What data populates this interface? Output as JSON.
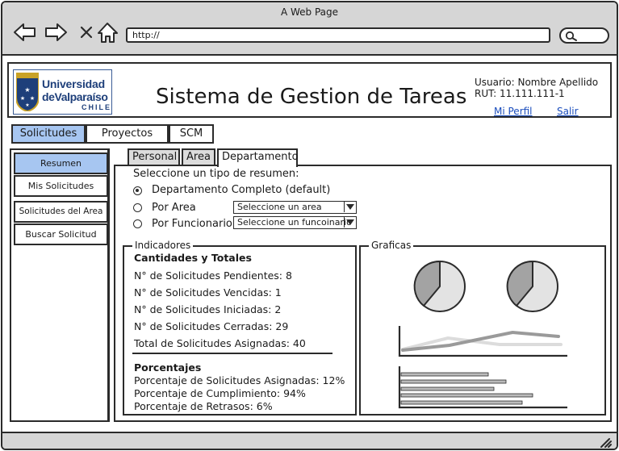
{
  "browser": {
    "title": "A Web Page",
    "url": "http://"
  },
  "header": {
    "logo": {
      "line1": "Universidad",
      "line2": "deValparaíso",
      "line3": "CHILE"
    },
    "title": "Sistema de Gestion de Tareas",
    "user_label": "Usuario: Nombre Apellido",
    "rut_label": "RUT: 11.111.111-1",
    "profile_link": "Mi Perfil",
    "logout_link": "Salir"
  },
  "top_tabs": [
    {
      "label": "Solicitudes",
      "active": true
    },
    {
      "label": "Proyectos",
      "active": false
    },
    {
      "label": "SCM",
      "active": false
    }
  ],
  "sidebar": {
    "items": [
      {
        "label": "Resumen",
        "active": true
      },
      {
        "label": "Mis Solicitudes",
        "active": false
      },
      {
        "label": "Solicitudes del Area",
        "active": false
      },
      {
        "label": "Buscar Solicitud",
        "active": false
      }
    ]
  },
  "sub_tabs": [
    {
      "label": "Personal",
      "active": false
    },
    {
      "label": "Area",
      "active": false
    },
    {
      "label": "Departamento",
      "active": true
    }
  ],
  "summary_type": {
    "prompt": "Seleccione un tipo de resumen:",
    "options": [
      {
        "label": "Departamento Completo (default)",
        "selected": true
      },
      {
        "label": "Por Area",
        "selected": false,
        "select_value": "Seleccione un area"
      },
      {
        "label": "Por Funcionario",
        "selected": false,
        "select_value": "Seleccione un funcoinario"
      }
    ]
  },
  "indicators": {
    "legend": "Indicadores",
    "totals_title": "Cantidades y Totales",
    "totals": [
      "N° de Solicitudes Pendientes: 8",
      "N° de Solicitudes Vencidas: 1",
      "N° de Solicitudes Iniciadas: 2",
      "N° de Solicitudes Cerradas: 29",
      "Total de Solicitudes Asignadas: 40"
    ],
    "percent_title": "Porcentajes",
    "percentages": [
      "Porcentaje de Solicitudes Asignadas: 12%",
      "Porcentaje de Cumplimiento: 94%",
      "Porcentaje de Retrasos: 6%"
    ]
  },
  "graphs": {
    "legend": "Graficas"
  },
  "colors": {
    "active_tab": "#a7c6f1",
    "chrome": "#d6d6d6",
    "link": "#1a4dbd",
    "logo_blue": "#1e3f7a",
    "pie_dark": "#a3a3a3",
    "pie_light": "#e3e3e3",
    "line_dark": "#9a9a9a",
    "line_light": "#dcdcdc"
  },
  "icons": [
    "back-arrow-icon",
    "forward-arrow-icon",
    "close-x-icon",
    "home-icon",
    "search-icon",
    "resize-grip-icon",
    "university-shield-icon"
  ]
}
